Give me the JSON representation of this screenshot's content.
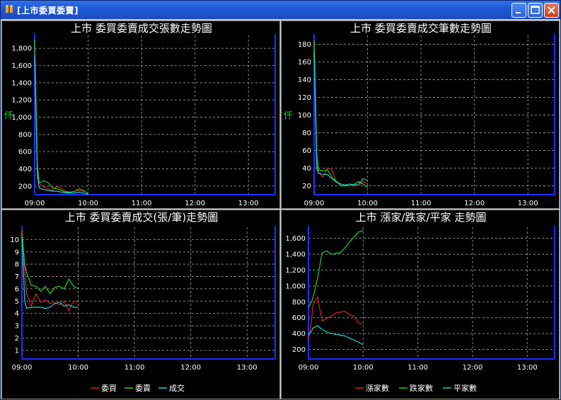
{
  "window": {
    "title": "[上市委買委賣]"
  },
  "colors": {
    "red": "#e02020",
    "green": "#20d020",
    "cyan": "#20d0d0",
    "axis": "#2030ff",
    "grid": "#8a8a8a",
    "text": "#ffffff"
  },
  "icons": {
    "app": "people-icon",
    "minimize": "minimize-icon",
    "maximize": "maximize-icon",
    "close": "close-icon"
  },
  "chart_data": [
    {
      "type": "line",
      "title": "上市  委買委賣成交張數走勢圖",
      "ylabel": "仟",
      "x_ticks": [
        "09:00",
        "10:00",
        "11:00",
        "12:00",
        "13:00"
      ],
      "xlim": [
        "09:00",
        "13:30"
      ],
      "y_ticks": [
        "200",
        "400",
        "600",
        "800",
        "1,000",
        "1,200",
        "1,400",
        "1,600",
        "1,800"
      ],
      "ylim": [
        100,
        1950
      ],
      "grid": true,
      "series": [
        {
          "color": "red",
          "x": [
            "09:00",
            "09:03",
            "09:05",
            "09:10",
            "09:15",
            "09:20",
            "09:25",
            "09:30",
            "09:35",
            "09:40",
            "09:45",
            "09:50",
            "09:55",
            "10:00"
          ],
          "values": [
            1850,
            300,
            240,
            190,
            170,
            150,
            200,
            170,
            140,
            130,
            140,
            150,
            140,
            120
          ]
        },
        {
          "color": "green",
          "x": [
            "09:00",
            "09:03",
            "09:05",
            "09:10",
            "09:15",
            "09:20",
            "09:25",
            "09:30",
            "09:35",
            "09:40",
            "09:45",
            "09:50",
            "09:55",
            "10:00"
          ],
          "values": [
            1900,
            450,
            240,
            260,
            240,
            180,
            170,
            150,
            130,
            130,
            140,
            170,
            150,
            110
          ]
        },
        {
          "color": "cyan",
          "x": [
            "09:00",
            "09:03",
            "09:05",
            "09:10",
            "09:15",
            "09:20",
            "09:25",
            "09:30",
            "09:35",
            "09:40",
            "09:45",
            "09:50",
            "09:55",
            "10:00"
          ],
          "values": [
            1700,
            350,
            180,
            160,
            150,
            140,
            140,
            130,
            120,
            120,
            120,
            130,
            120,
            100
          ]
        }
      ]
    },
    {
      "type": "line",
      "title": "上市  委買委賣成交筆數走勢圖",
      "ylabel": "仟",
      "x_ticks": [
        "09:00",
        "10:00",
        "11:00",
        "12:00",
        "13:00"
      ],
      "xlim": [
        "09:00",
        "13:30"
      ],
      "y_ticks": [
        "20",
        "40",
        "60",
        "80",
        "100",
        "120",
        "140",
        "160",
        "180"
      ],
      "ylim": [
        10,
        190
      ],
      "grid": true,
      "series": [
        {
          "color": "red",
          "x": [
            "09:00",
            "09:03",
            "09:05",
            "09:10",
            "09:15",
            "09:20",
            "09:25",
            "09:30",
            "09:35",
            "09:40",
            "09:45",
            "09:50",
            "09:55",
            "10:00"
          ],
          "values": [
            180,
            45,
            35,
            30,
            40,
            38,
            25,
            22,
            20,
            22,
            20,
            20,
            25,
            22
          ]
        },
        {
          "color": "green",
          "x": [
            "09:00",
            "09:03",
            "09:05",
            "09:10",
            "09:15",
            "09:20",
            "09:25",
            "09:30",
            "09:35",
            "09:40",
            "09:45",
            "09:50",
            "09:55",
            "10:00"
          ],
          "values": [
            185,
            55,
            38,
            37,
            38,
            30,
            25,
            20,
            20,
            20,
            22,
            25,
            22,
            18
          ]
        },
        {
          "color": "cyan",
          "x": [
            "09:00",
            "09:03",
            "09:05",
            "09:10",
            "09:15",
            "09:20",
            "09:25",
            "09:30",
            "09:35",
            "09:40",
            "09:45",
            "09:50",
            "09:55",
            "10:00"
          ],
          "values": [
            170,
            40,
            34,
            33,
            33,
            28,
            24,
            22,
            21,
            22,
            21,
            22,
            28,
            26
          ]
        }
      ]
    },
    {
      "type": "line",
      "title": "上市  委買委賣成交(張/筆)走勢圖",
      "ylabel": "",
      "x_ticks": [
        "09:00",
        "10:00",
        "11:00",
        "12:00",
        "13:00"
      ],
      "xlim": [
        "09:00",
        "13:30"
      ],
      "y_ticks": [
        "1",
        "2",
        "3",
        "4",
        "5",
        "6",
        "7",
        "8",
        "9",
        "10"
      ],
      "ylim": [
        0.3,
        11
      ],
      "grid": true,
      "legend": "bottom",
      "series": [
        {
          "name": "委買",
          "color": "red",
          "x": [
            "09:00",
            "09:03",
            "09:05",
            "09:10",
            "09:15",
            "09:20",
            "09:25",
            "09:30",
            "09:35",
            "09:40",
            "09:45",
            "09:50",
            "09:55",
            "10:00"
          ],
          "values": [
            10.8,
            7.5,
            5.6,
            4.6,
            5.6,
            4.9,
            5.1,
            4.8,
            4.9,
            4.7,
            5.0,
            4.2,
            5.0,
            4.9
          ]
        },
        {
          "name": "委賣",
          "color": "green",
          "x": [
            "09:00",
            "09:03",
            "09:05",
            "09:10",
            "09:15",
            "09:20",
            "09:25",
            "09:30",
            "09:35",
            "09:40",
            "09:45",
            "09:50",
            "09:55",
            "10:00"
          ],
          "values": [
            10.5,
            8.0,
            7.3,
            6.3,
            6.2,
            5.8,
            6.2,
            5.6,
            6.1,
            6.2,
            6.0,
            6.8,
            6.2,
            6.0
          ]
        },
        {
          "name": "成交",
          "color": "cyan",
          "x": [
            "09:00",
            "09:03",
            "09:05",
            "09:10",
            "09:15",
            "09:20",
            "09:25",
            "09:30",
            "09:35",
            "09:40",
            "09:45",
            "09:50",
            "09:55",
            "10:00"
          ],
          "values": [
            10.2,
            5.0,
            4.4,
            4.5,
            4.5,
            4.5,
            4.4,
            4.5,
            4.8,
            4.9,
            4.6,
            4.7,
            4.5,
            4.5
          ]
        }
      ]
    },
    {
      "type": "line",
      "title": "上市  漲家/跌家/平家  走勢圖",
      "ylabel": "",
      "x_ticks": [
        "09:00",
        "10:00",
        "11:00",
        "12:00",
        "13:00"
      ],
      "xlim": [
        "09:00",
        "13:30"
      ],
      "y_ticks": [
        "200",
        "400",
        "600",
        "800",
        "1,000",
        "1,200",
        "1,400",
        "1,600"
      ],
      "ylim": [
        80,
        1740
      ],
      "grid": true,
      "legend": "bottom",
      "series": [
        {
          "name": "漲家數",
          "color": "red",
          "x": [
            "09:00",
            "09:03",
            "09:05",
            "09:10",
            "09:15",
            "09:20",
            "09:25",
            "09:30",
            "09:35",
            "09:40",
            "09:45",
            "09:50",
            "09:55",
            "10:00"
          ],
          "values": [
            330,
            520,
            760,
            860,
            560,
            590,
            620,
            660,
            670,
            680,
            640,
            620,
            530,
            520
          ]
        },
        {
          "name": "跌家數",
          "color": "green",
          "x": [
            "09:00",
            "09:03",
            "09:05",
            "09:10",
            "09:15",
            "09:20",
            "09:25",
            "09:30",
            "09:35",
            "09:40",
            "09:45",
            "09:50",
            "09:55",
            "10:00"
          ],
          "values": [
            730,
            790,
            850,
            1100,
            1420,
            1440,
            1400,
            1410,
            1420,
            1480,
            1550,
            1620,
            1680,
            1700
          ]
        },
        {
          "name": "平家數",
          "color": "cyan",
          "x": [
            "09:00",
            "09:03",
            "09:05",
            "09:10",
            "09:15",
            "09:20",
            "09:25",
            "09:30",
            "09:35",
            "09:40",
            "09:45",
            "09:50",
            "09:55",
            "10:00"
          ],
          "values": [
            380,
            420,
            470,
            500,
            450,
            420,
            400,
            390,
            380,
            370,
            340,
            320,
            290,
            260
          ]
        }
      ]
    }
  ]
}
